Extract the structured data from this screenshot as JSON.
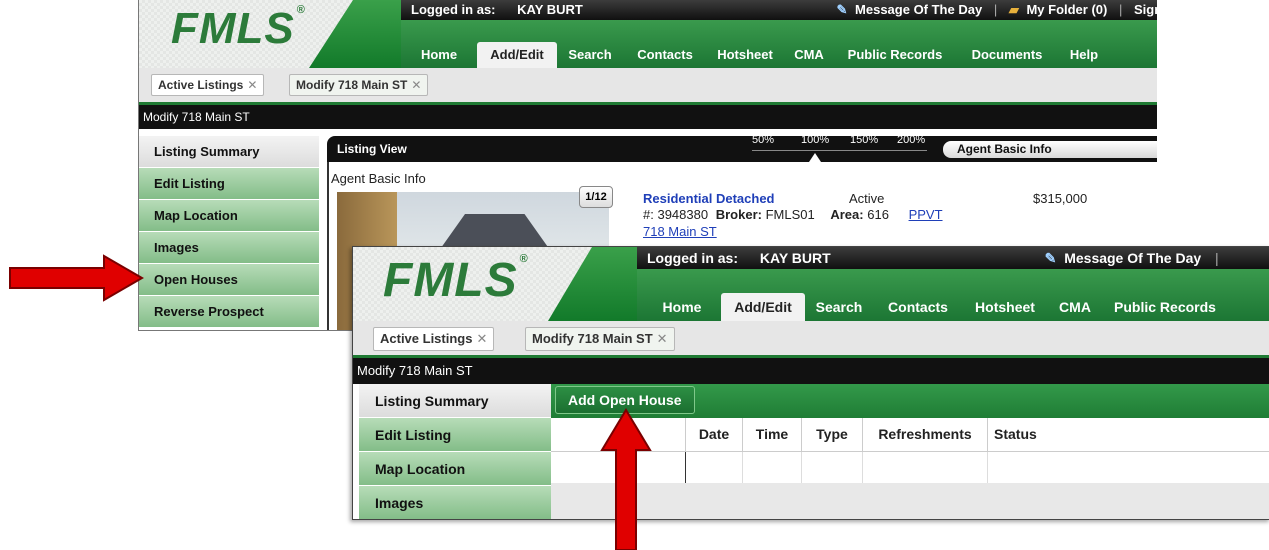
{
  "colors": {
    "brand_green": "#1f7a33",
    "nav_green": "#2e8b44",
    "sidebar_green": "#9fcfa3",
    "link_blue": "#1f3fb8",
    "arrow_red": "#e00000"
  },
  "shot1": {
    "logo": "FMLS",
    "logged_in_label": "Logged in as:",
    "user_name": "KAY BURT",
    "motd": "Message Of The Day",
    "sep1": "|",
    "my_folder": "My Folder (0)",
    "sep2": "|",
    "sign": "Sign",
    "nav": [
      "Home",
      "Add/Edit",
      "Search",
      "Contacts",
      "Hotsheet",
      "CMA",
      "Public Records",
      "Documents",
      "Help"
    ],
    "subtabs": [
      "Active Listings",
      "Modify 718 Main ST"
    ],
    "page_title": "Modify 718 Main ST",
    "sidebar": [
      "Listing Summary",
      "Edit Listing",
      "Map Location",
      "Images",
      "Open Houses",
      "Reverse Prospect"
    ],
    "listing_view": {
      "title": "Listing View",
      "zoom": [
        "50%",
        "100%",
        "150%",
        "200%"
      ],
      "view_select": "Agent Basic Info",
      "subheading": "Agent Basic Info",
      "photo_counter": "1/12",
      "property_type": "Residential Detached",
      "status": "Active",
      "price": "$315,000",
      "listing_no_label": "#:",
      "listing_no": "3948380",
      "broker_label": "Broker:",
      "broker": "FMLS01",
      "area_label": "Area:",
      "area": "616",
      "ppvt": "PPVT",
      "address": "718 Main ST"
    }
  },
  "shot2": {
    "logo": "FMLS",
    "logged_in_label": "Logged in as:",
    "user_name": "KAY BURT",
    "motd": "Message Of The Day",
    "sep1": "|",
    "nav": [
      "Home",
      "Add/Edit",
      "Search",
      "Contacts",
      "Hotsheet",
      "CMA",
      "Public Records"
    ],
    "subtabs": [
      "Active Listings",
      "Modify 718 Main ST"
    ],
    "page_title": "Modify 718 Main ST",
    "sidebar": [
      "Listing Summary",
      "Edit Listing",
      "Map Location",
      "Images"
    ],
    "add_button": "Add Open House",
    "table_headers": [
      "",
      "Date",
      "Time",
      "Type",
      "Refreshments",
      "Status"
    ]
  }
}
